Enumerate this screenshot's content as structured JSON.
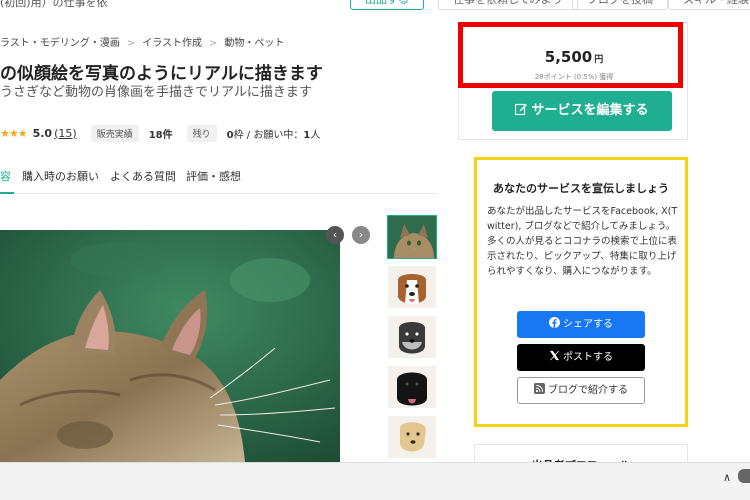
{
  "top": {
    "crumb_partial": "(初回)用）の仕事を依",
    "buttons": [
      "出品する",
      "仕事を依頼してみよう",
      "ブログを投稿",
      "スキル・経験を登"
    ]
  },
  "breadcrumb": [
    "ラスト・モデリング・漫画",
    "イラスト作成",
    "動物・ペット"
  ],
  "title": "の似顔絵を写真のようにリアルに描きます",
  "subtitle": "うさぎなど動物の肖像画を手描きでリアルに描きます",
  "stats": {
    "stars": "★★★",
    "rating": "5.0",
    "rating_count": "(15)",
    "sales_label": "販売実績",
    "sales_value": "18件",
    "remaining_label": "残り",
    "remaining_value": "0",
    "remaining_suffix": "枠 / お願い中：",
    "requesting_value": "1",
    "requesting_suffix": "人"
  },
  "tabs": [
    "容",
    "購入時のお願い",
    "よくある質問",
    "評価・感想"
  ],
  "gallery": {
    "prev_icon": "chevron-left-icon",
    "next_icon": "chevron-right-icon",
    "thumbnails": [
      "cat-portrait",
      "beagle-portrait",
      "schnauzer-portrait",
      "black-lab-portrait",
      "yellow-lab-portrait"
    ]
  },
  "price": {
    "value": "5,500",
    "unit": "円",
    "points": "28ポイント (0.5%) 獲得"
  },
  "edit_button": "サービスを編集する",
  "promo": {
    "title": "あなたのサービスを宣伝しましょう",
    "body_1": "あなたが出品したサービスをFacebook, X(Twitter), ブログなどで紹介してみましょう。",
    "body_2": "多くの人が見るとココナラの検索で上位に表示されたり、ピックアップ、特集に取り上げられやすくなり、購入につながります。",
    "share_facebook": "シェアする",
    "share_x": "ポストする",
    "share_blog": "ブログで紹介する"
  },
  "profile_title": "出品者プロフィール",
  "colors": {
    "accent": "#1fae8f",
    "highlight": "#ee0000",
    "promo_border": "#f5d20f",
    "facebook": "#1877f2"
  }
}
